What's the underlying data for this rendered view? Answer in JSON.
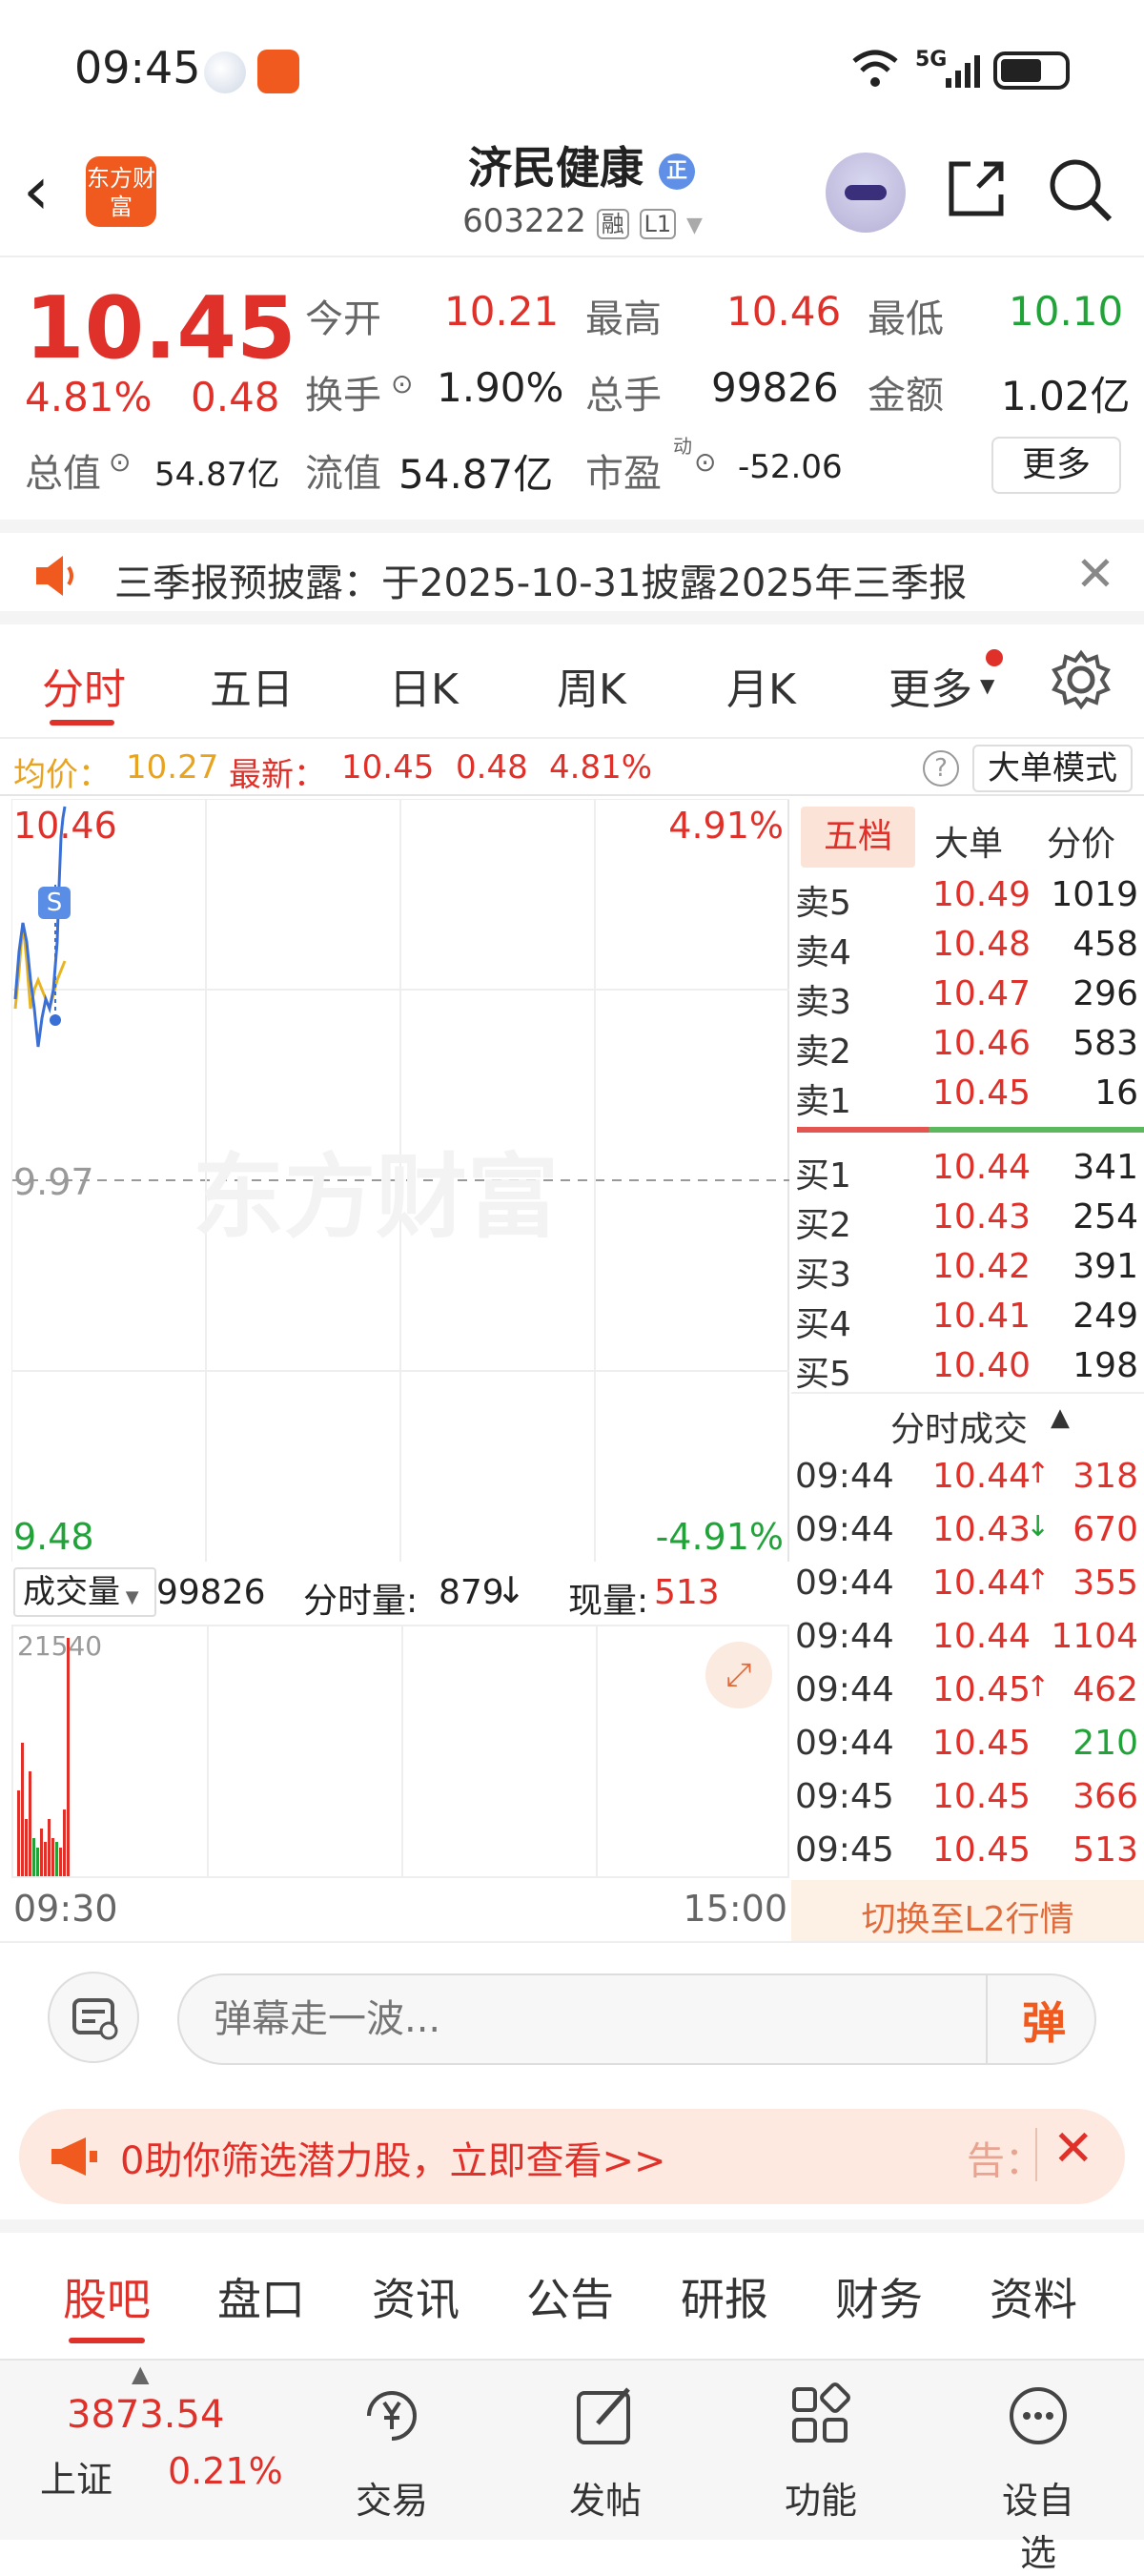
{
  "status": {
    "time": "09:45",
    "network": "5G"
  },
  "header": {
    "brand_logo_text": "东方财富",
    "title": "济民健康",
    "title_badge": "正",
    "code": "603222",
    "tag1": "融",
    "tag2": "L1"
  },
  "quote": {
    "price": "10.45",
    "change_pct": "4.81%",
    "change": "0.48",
    "open_label": "今开",
    "open": "10.21",
    "high_label": "最高",
    "high": "10.46",
    "low_label": "最低",
    "low": "10.10",
    "turnover_label": "换手",
    "turnover": "1.90%",
    "volume_label": "总手",
    "volume": "99826",
    "amount_label": "金额",
    "amount": "1.02亿",
    "mktcap_label": "总值",
    "mktcap": "54.87亿",
    "float_label": "流值",
    "float": "54.87亿",
    "pe_label": "市盈",
    "pe_sup": "动",
    "pe": "-52.06",
    "more_button": "更多"
  },
  "notice": {
    "text": "三季报预披露：于2025-10-31披露2025年三季报"
  },
  "tabs": [
    "分时",
    "五日",
    "日K",
    "周K",
    "月K",
    "更多"
  ],
  "avgline": {
    "avg_label": "均价：",
    "avg": "10.27",
    "latest_label": "最新：",
    "latest": "10.45",
    "chg": "0.48",
    "pct": "4.81%",
    "mode_button": "大单模式"
  },
  "chart": {
    "top_price": "10.46",
    "top_pct": "4.91%",
    "mid_price": "9.97",
    "bottom_price": "9.48",
    "bottom_pct": "-4.91%",
    "watermark": "东方财富",
    "marker": "S"
  },
  "volbar": {
    "label": "成交量",
    "total": "99826",
    "period_label": "分时量:",
    "period": "879",
    "now_label": "现量:",
    "now": "513",
    "max": "21540"
  },
  "times": {
    "start": "09:30",
    "end": "15:00"
  },
  "book": {
    "tabs": [
      "五档",
      "大单",
      "分价"
    ],
    "asks": [
      {
        "label": "卖5",
        "price": "10.49",
        "vol": "1019"
      },
      {
        "label": "卖4",
        "price": "10.48",
        "vol": "458"
      },
      {
        "label": "卖3",
        "price": "10.47",
        "vol": "296"
      },
      {
        "label": "卖2",
        "price": "10.46",
        "vol": "583"
      },
      {
        "label": "卖1",
        "price": "10.45",
        "vol": "16"
      }
    ],
    "bids": [
      {
        "label": "买1",
        "price": "10.44",
        "vol": "341"
      },
      {
        "label": "买2",
        "price": "10.43",
        "vol": "254"
      },
      {
        "label": "买3",
        "price": "10.42",
        "vol": "391"
      },
      {
        "label": "买4",
        "price": "10.41",
        "vol": "249"
      },
      {
        "label": "买5",
        "price": "10.40",
        "vol": "198"
      }
    ],
    "trades_title": "分时成交",
    "trades": [
      {
        "time": "09:44",
        "price": "10.44",
        "dir": "↑",
        "vol": "318"
      },
      {
        "time": "09:44",
        "price": "10.43",
        "dir": "↓",
        "vol": "670"
      },
      {
        "time": "09:44",
        "price": "10.44",
        "dir": "↑",
        "vol": "355"
      },
      {
        "time": "09:44",
        "price": "10.44",
        "dir": "",
        "vol": "1104"
      },
      {
        "time": "09:44",
        "price": "10.45",
        "dir": "↑",
        "vol": "462"
      },
      {
        "time": "09:44",
        "price": "10.45",
        "dir": "",
        "vol": "210"
      },
      {
        "time": "09:45",
        "price": "10.45",
        "dir": "",
        "vol": "366"
      },
      {
        "time": "09:45",
        "price": "10.45",
        "dir": "",
        "vol": "513"
      }
    ],
    "l2_button": "切换至L2行情"
  },
  "danmu": {
    "placeholder": "弹幕走一波...",
    "send": "弹"
  },
  "banner": {
    "text": "0助你筛选潜力股，立即查看>>",
    "tail": "告："
  },
  "subtabs": [
    "股吧",
    "盘口",
    "资讯",
    "公告",
    "研报",
    "财务",
    "资料"
  ],
  "footer": {
    "index_value": "3873.54",
    "index_name": "上证",
    "index_pct": "0.21%",
    "items": [
      "交易",
      "发帖",
      "功能",
      "设自选"
    ]
  },
  "colors": {
    "up": "#e0302a",
    "down": "#21a33a",
    "accent": "#f05a1e"
  }
}
